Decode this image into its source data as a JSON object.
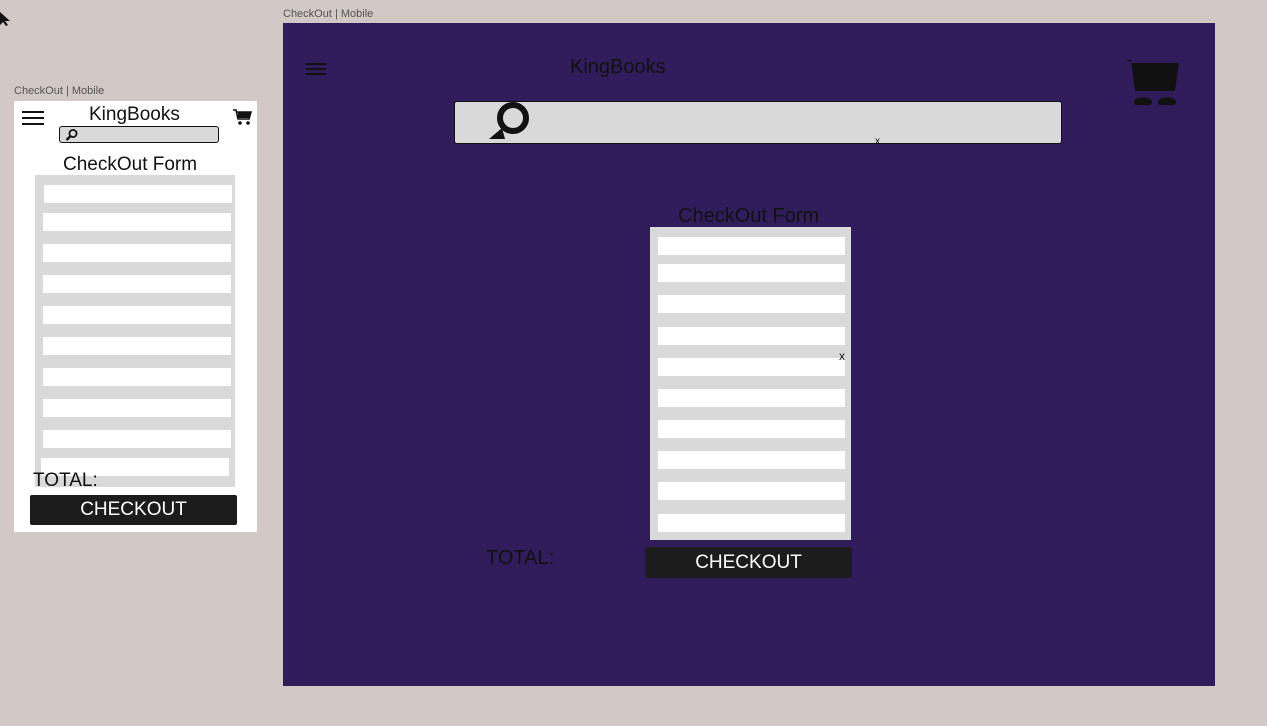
{
  "mobile": {
    "frame_label": "CheckOut | Mobile",
    "brand": "KingBooks",
    "form_title": "CheckOut Form",
    "total_label": "TOTAL:",
    "checkout_label": "CHECKOUT",
    "fields": [
      "",
      "",
      "",
      "",
      "",
      "",
      "",
      "",
      "",
      ""
    ]
  },
  "desktop": {
    "frame_label": "CheckOut | Mobile",
    "brand": "KingBooks",
    "search_clear": "x",
    "form_title": "CheckOut Form",
    "form_marker": "x",
    "total_label": "TOTAL:",
    "checkout_label": "CHECKOUT",
    "fields": [
      "",
      "",
      "",
      "",
      "",
      "",
      "",
      "",
      "",
      ""
    ]
  },
  "colors": {
    "canvas": "#d2c8c6",
    "desktop_bg": "#301b5b",
    "form_bg": "#d9d9d9",
    "button_bg": "#1c1c1c"
  },
  "icons": [
    "menu-icon",
    "cart-icon",
    "search-icon",
    "cursor-icon"
  ]
}
